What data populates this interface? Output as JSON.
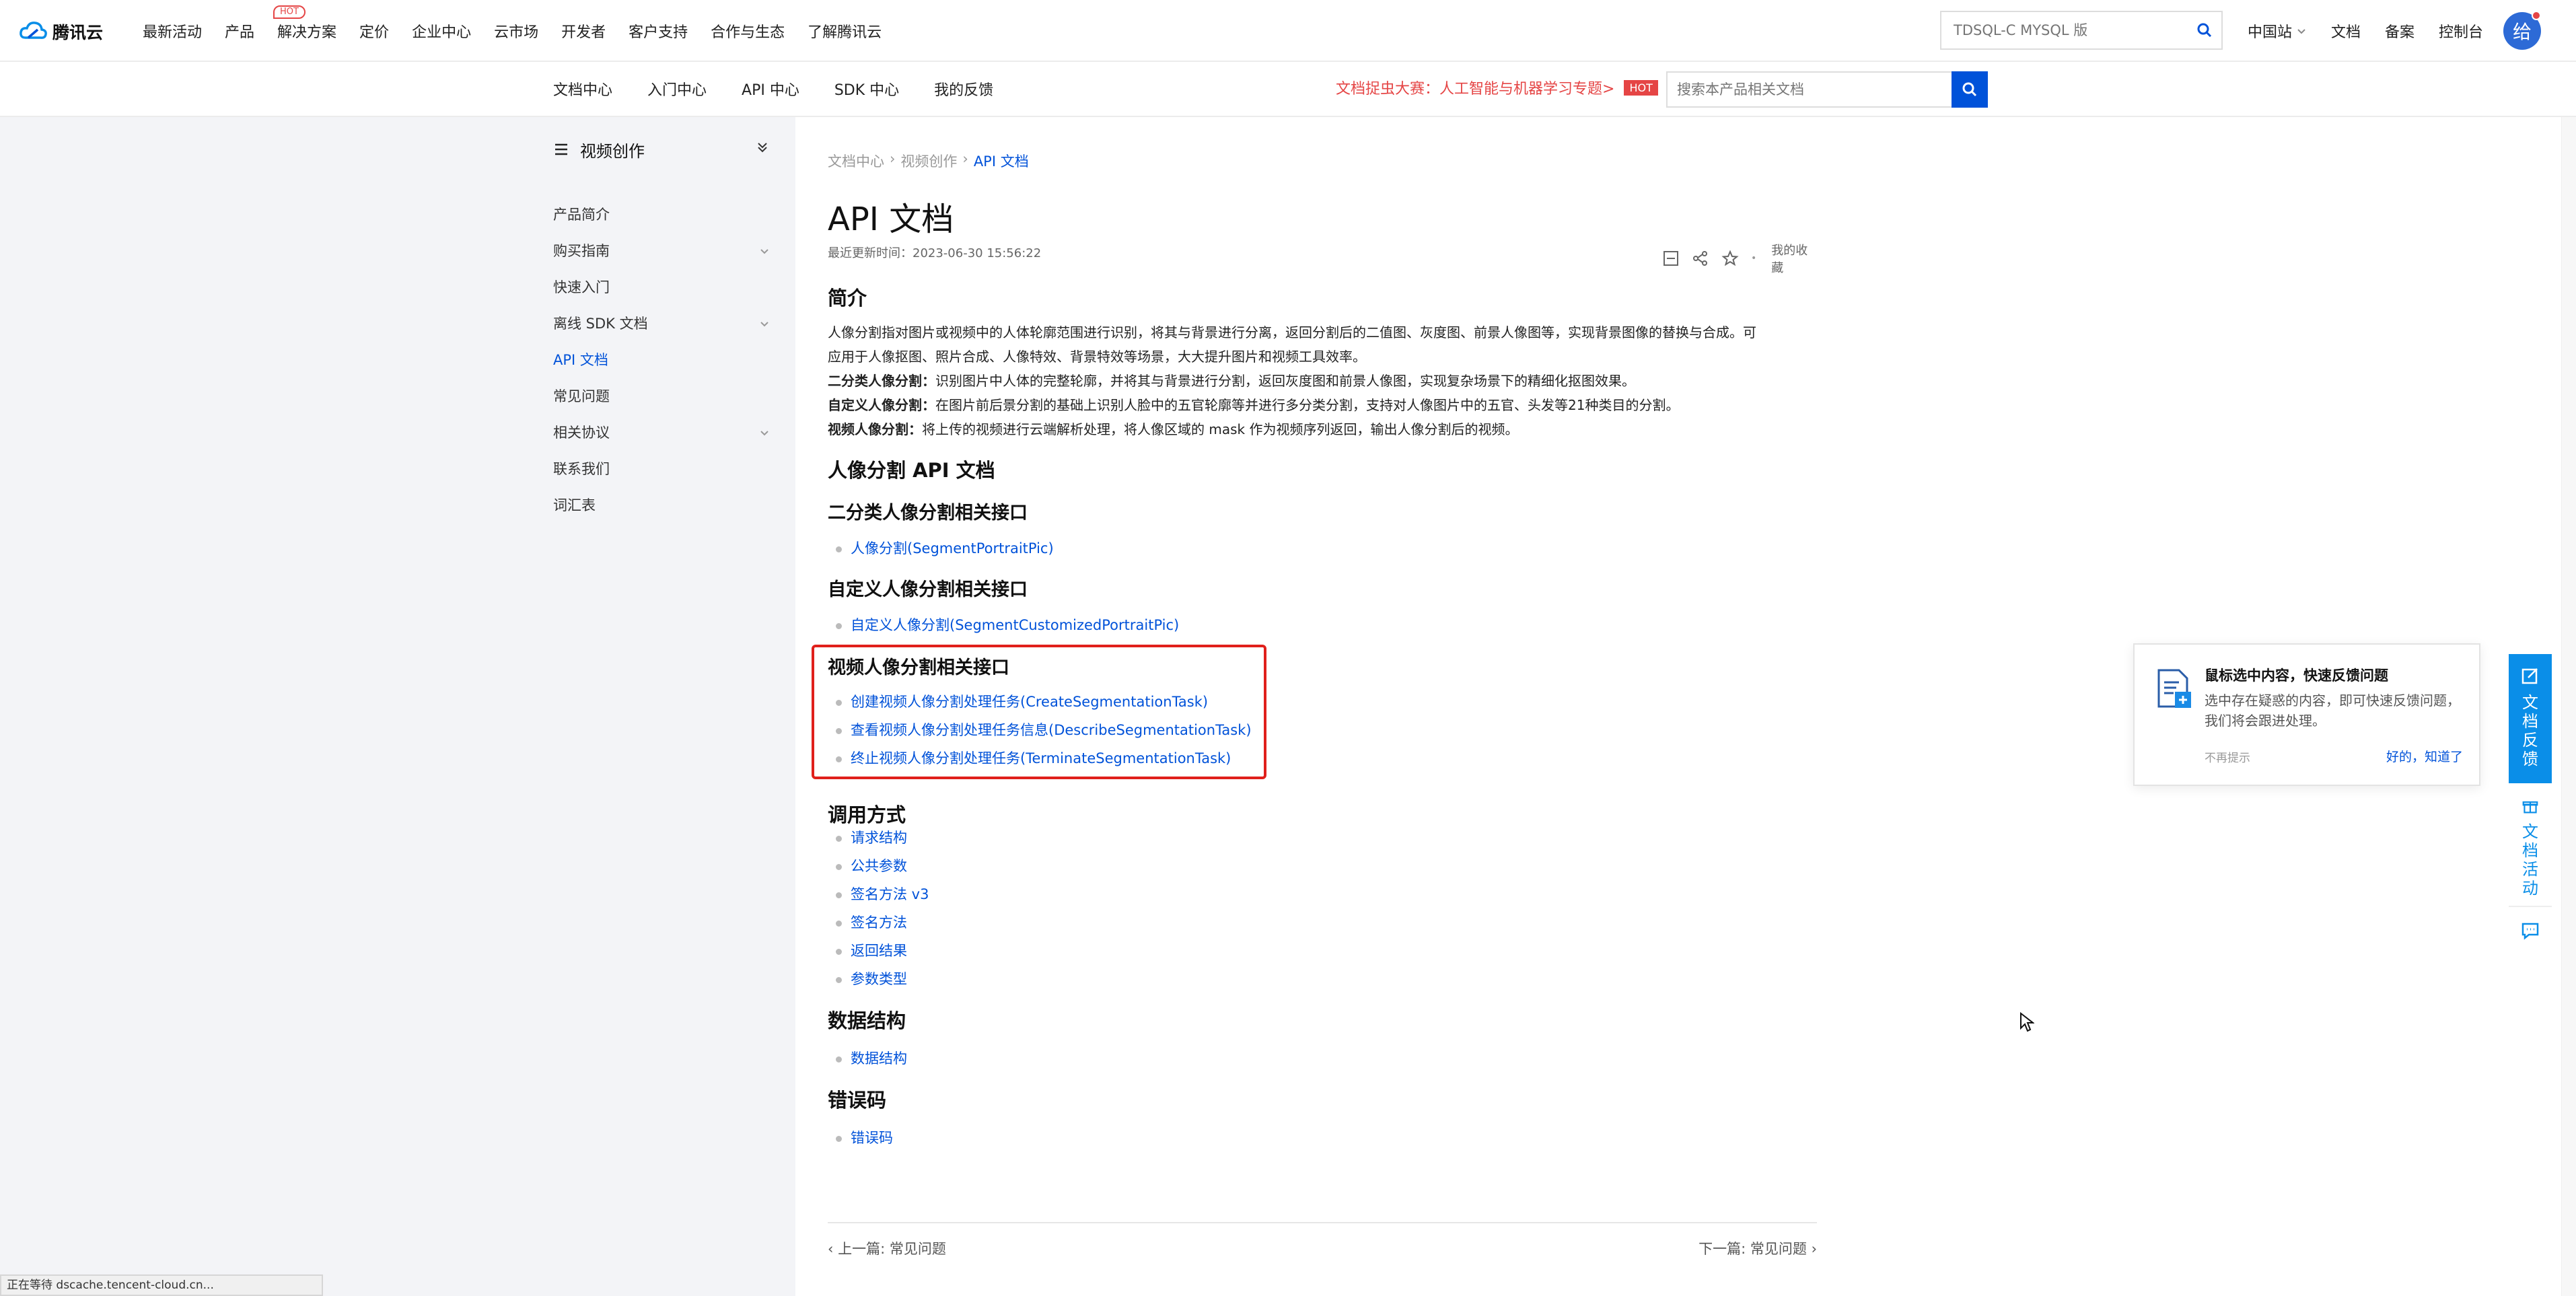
{
  "topnav": {
    "logo_text": "腾讯云",
    "menu": [
      "最新活动",
      "产品",
      "解决方案",
      "定价",
      "企业中心",
      "云市场",
      "开发者",
      "客户支持",
      "合作与生态",
      "了解腾讯云"
    ],
    "hot_badge": "HOT",
    "search_placeholder": "TDSQL-C MYSQL 版",
    "region": "中国站",
    "docs": "文档",
    "record": "备案",
    "console": "控制台",
    "avatar_text": "给"
  },
  "subnav": {
    "items": [
      "文档中心",
      "入门中心",
      "API 中心",
      "SDK 中心",
      "我的反馈"
    ],
    "promo": "文档捉虫大赛：人工智能与机器学习专题>",
    "promo_badge": "HOT",
    "search_placeholder": "搜索本产品相关文档"
  },
  "sidebar": {
    "title": "视频创作",
    "items": [
      {
        "label": "产品简介"
      },
      {
        "label": "购买指南"
      },
      {
        "label": "快速入门"
      },
      {
        "label": "离线 SDK 文档"
      },
      {
        "label": "API 文档"
      },
      {
        "label": "常见问题"
      },
      {
        "label": "相关协议"
      },
      {
        "label": "联系我们"
      },
      {
        "label": "词汇表"
      }
    ]
  },
  "main": {
    "breadcrumb": [
      "文档中心",
      "视频创作",
      "API 文档"
    ],
    "title": "API 文档",
    "updated": "最近更新时间：2023-06-30 15:56:22",
    "favorite": "我的收藏",
    "intro_heading": "简介",
    "intro_line1": "人像分割指对图片或视频中的人体轮廓范围进行识别，将其与背景进行分离，返回分割后的二值图、灰度图、前景人像图等，实现背景图像的替换与合成。可",
    "intro_line2": "应用于人像抠图、照片合成、人像特效、背景特效等场景，大大提升图片和视频工具效率。",
    "b1_label": "二分类人像分割：",
    "b1_text": "识别图片中人体的完整轮廓，并将其与背景进行分割，返回灰度图和前景人像图，实现复杂场景下的精细化抠图效果。",
    "b2_label": "自定义人像分割：",
    "b2_text": "在图片前后景分割的基础上识别人脸中的五官轮廓等并进行多分类分割，支持对人像图片中的五官、头发等21种类目的分割。",
    "b3_label": "视频人像分割：",
    "b3_text": "将上传的视频进行云端解析处理，将人像区域的 mask 作为视频序列返回，输出人像分割后的视频。",
    "api_heading": "人像分割 API 文档",
    "sec1_heading": "二分类人像分割相关接口",
    "sec1_links": [
      "人像分割(SegmentPortraitPic)"
    ],
    "sec2_heading": "自定义人像分割相关接口",
    "sec2_links": [
      "自定义人像分割(SegmentCustomizedPortraitPic)"
    ],
    "sec3_heading": "视频人像分割相关接口",
    "sec3_links": [
      "创建视频人像分割处理任务(CreateSegmentationTask)",
      "查看视频人像分割处理任务信息(DescribeSegmentationTask)",
      "终止视频人像分割处理任务(TerminateSegmentationTask)"
    ],
    "call_heading": "调用方式",
    "call_links": [
      "请求结构",
      "公共参数",
      "签名方法 v3",
      "签名方法",
      "返回结果",
      "参数类型"
    ],
    "ds_heading": "数据结构",
    "ds_links": [
      "数据结构"
    ],
    "err_heading": "错误码",
    "err_links": [
      "错误码"
    ],
    "prev": "上一篇: 常见问题",
    "next": "下一篇: 常见问题"
  },
  "popover": {
    "title": "鼠标选中内容，快速反馈问题",
    "desc": "选中存在疑惑的内容，即可快速反馈问题，我们将会跟进处理。",
    "no_show": "不再提示",
    "ok": "好的，知道了"
  },
  "float": {
    "feedback": "文档反馈",
    "activity": "文档活动"
  },
  "status": "正在等待 dscache.tencent-cloud.cn..."
}
